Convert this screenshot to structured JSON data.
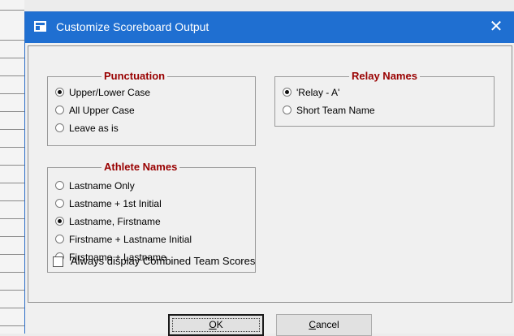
{
  "window": {
    "title": "Customize Scoreboard Output",
    "close_glyph": "✕",
    "title_icon": "app-window-icon"
  },
  "punctuation": {
    "title": "Punctuation",
    "options": [
      {
        "label": "Upper/Lower Case",
        "selected": true
      },
      {
        "label": "All Upper Case",
        "selected": false
      },
      {
        "label": "Leave as is",
        "selected": false
      }
    ]
  },
  "relay_names": {
    "title": "Relay Names",
    "options": [
      {
        "label": "'Relay - A'",
        "selected": true
      },
      {
        "label": "Short Team Name",
        "selected": false
      }
    ]
  },
  "athlete_names": {
    "title": "Athlete Names",
    "options": [
      {
        "label": "Lastname Only",
        "selected": false
      },
      {
        "label": "Lastname + 1st Initial",
        "selected": false
      },
      {
        "label": "Lastname, Firstname",
        "selected": true
      },
      {
        "label": "Firstname + Lastname Initial",
        "selected": false
      },
      {
        "label": "Firstname +  Lastname",
        "selected": false
      }
    ]
  },
  "combined_scores": {
    "label": "Always display Combined Team Scores",
    "checked": false
  },
  "buttons": {
    "ok": {
      "mnemonic": "O",
      "rest": "K"
    },
    "cancel": {
      "mnemonic": "C",
      "rest": "ancel"
    }
  },
  "colors": {
    "titlebar": "#1f6fd1",
    "group_title": "#990000"
  }
}
